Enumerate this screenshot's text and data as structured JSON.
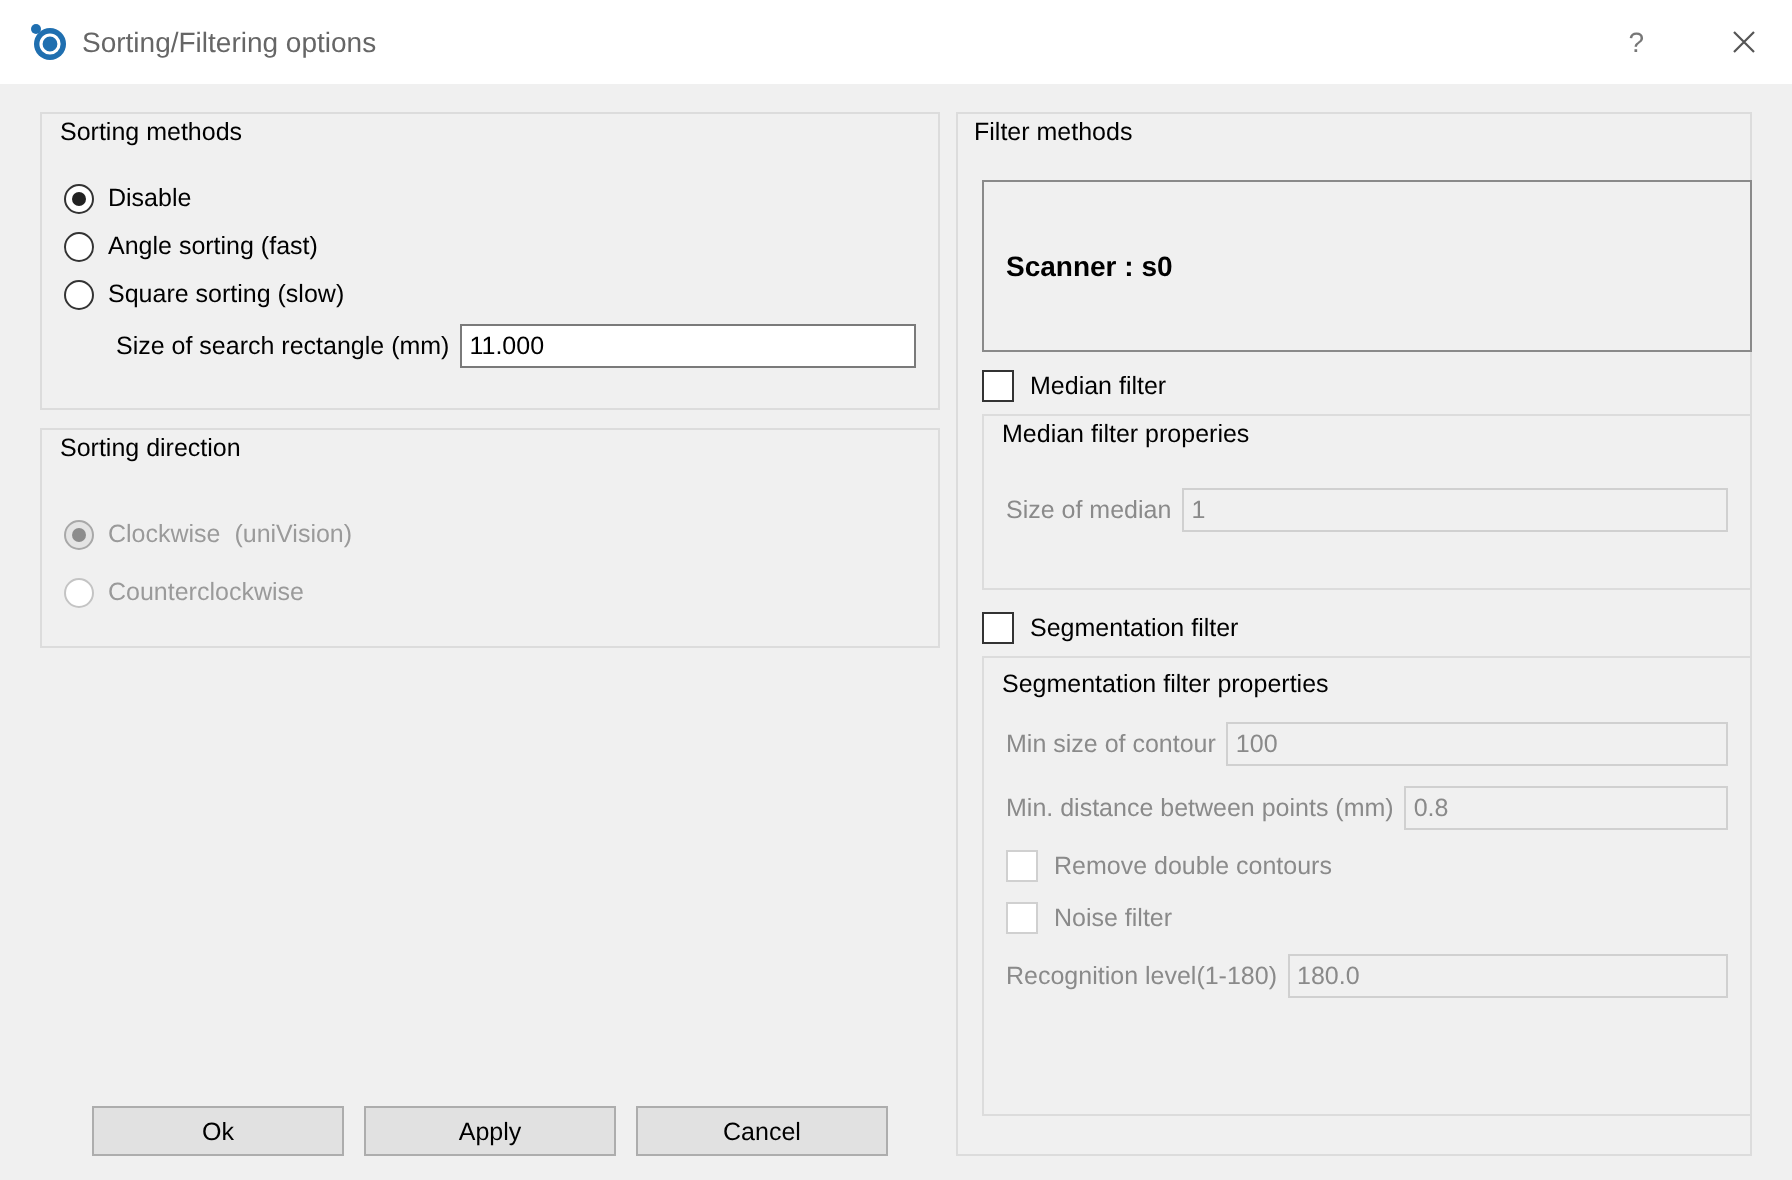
{
  "window": {
    "title": "Sorting/Filtering options",
    "help": "?"
  },
  "sorting_methods": {
    "title": "Sorting methods",
    "options": [
      {
        "label": "Disable",
        "selected": true
      },
      {
        "label": "Angle sorting (fast)",
        "selected": false
      },
      {
        "label": "Square sorting (slow)",
        "selected": false
      }
    ],
    "search_size": {
      "label": "Size of search rectangle (mm)",
      "value": "11.000"
    }
  },
  "sorting_direction": {
    "title": "Sorting direction",
    "disabled": true,
    "options": [
      {
        "label": "Clockwise  (uniVision)",
        "selected": true
      },
      {
        "label": "Counterclockwise",
        "selected": false
      }
    ]
  },
  "filter_methods": {
    "title": "Filter methods",
    "scanner": "Scanner :  s0",
    "median_filter": {
      "label": "Median filter",
      "checked": false
    },
    "median_properties": {
      "title": "Median filter properies",
      "disabled": true,
      "items": [
        {
          "kind": "field",
          "label": "Size of median",
          "value": "1"
        }
      ]
    },
    "segmentation_filter": {
      "label": "Segmentation filter",
      "checked": false
    },
    "segmentation_properties": {
      "title": "Segmentation filter properties",
      "disabled": true,
      "items": [
        {
          "kind": "field",
          "label": "Min size of contour",
          "value": "100"
        },
        {
          "kind": "field",
          "label": "Min. distance between points (mm)",
          "value": "0.8"
        },
        {
          "kind": "checkbox",
          "label": "Remove double contours",
          "checked": false
        },
        {
          "kind": "checkbox",
          "label": "Noise filter",
          "checked": false
        },
        {
          "kind": "field",
          "label": "Recognition level(1-180)",
          "value": "180.0"
        }
      ]
    }
  },
  "buttons": [
    "Ok",
    "Apply",
    "Cancel"
  ]
}
